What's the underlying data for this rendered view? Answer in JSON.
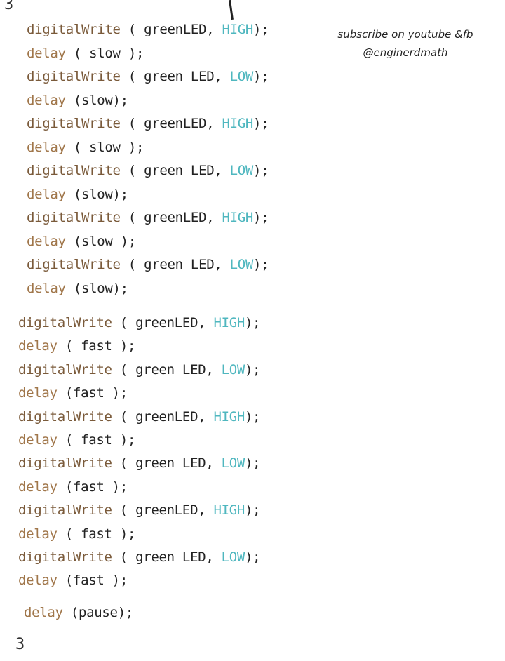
{
  "header": {
    "brace_open": "3",
    "brace_close": "3"
  },
  "note": {
    "line1": "subscribe on youtube &fb",
    "line2": "@enginerdmath"
  },
  "code": {
    "lines": [
      {
        "fn": "digitalWrite",
        "open": " ( ",
        "arg": "greenLED, ",
        "const": "HIGH",
        "close": ");"
      },
      {
        "fn": "delay",
        "open": " ( ",
        "arg": "slow",
        "const": "",
        "close": " );"
      },
      {
        "fn": "digitalWrite",
        "open": " ( ",
        "arg": "green LED, ",
        "const": "LOW",
        "close": ");"
      },
      {
        "fn": "delay",
        "open": " (",
        "arg": "slow",
        "const": "",
        "close": ");"
      },
      {
        "fn": "digitalWrite",
        "open": " ( ",
        "arg": "greenLED, ",
        "const": "HIGH",
        "close": ");"
      },
      {
        "fn": "delay",
        "open": " ( ",
        "arg": "slow",
        "const": "",
        "close": " );"
      },
      {
        "fn": "digitalWrite",
        "open": " ( ",
        "arg": "green LED, ",
        "const": "LOW",
        "close": ");"
      },
      {
        "fn": "delay",
        "open": " (",
        "arg": "slow",
        "const": "",
        "close": ");"
      },
      {
        "fn": "digitalWrite",
        "open": " ( ",
        "arg": "greenLED, ",
        "const": "HIGH",
        "close": ");"
      },
      {
        "fn": "delay",
        "open": " (",
        "arg": "slow",
        "const": "",
        "close": " );"
      },
      {
        "fn": "digitalWrite",
        "open": " ( ",
        "arg": "green LED, ",
        "const": "LOW",
        "close": ");"
      },
      {
        "fn": "delay",
        "open": " (",
        "arg": "slow",
        "const": "",
        "close": ");"
      },
      {
        "fn": "digitalWrite",
        "open": " ( ",
        "arg": "greenLED, ",
        "const": "HIGH",
        "close": ");"
      },
      {
        "fn": "delay",
        "open": " ( ",
        "arg": "fast",
        "const": "",
        "close": " );"
      },
      {
        "fn": "digitalWrite",
        "open": " ( ",
        "arg": "green LED, ",
        "const": "LOW",
        "close": ");"
      },
      {
        "fn": "delay",
        "open": " (",
        "arg": "fast",
        "const": "",
        "close": " );"
      },
      {
        "fn": "digitalWrite",
        "open": " ( ",
        "arg": "greenLED, ",
        "const": "HIGH",
        "close": ");"
      },
      {
        "fn": "delay",
        "open": " ( ",
        "arg": "fast",
        "const": "",
        "close": " );"
      },
      {
        "fn": "digitalWrite",
        "open": " ( ",
        "arg": "green LED, ",
        "const": "LOW",
        "close": ");"
      },
      {
        "fn": "delay",
        "open": " (",
        "arg": "fast",
        "const": "",
        "close": " );"
      },
      {
        "fn": "digitalWrite",
        "open": " ( ",
        "arg": "greenLED, ",
        "const": "HIGH",
        "close": ");"
      },
      {
        "fn": "delay",
        "open": " ( ",
        "arg": "fast",
        "const": "",
        "close": " );"
      },
      {
        "fn": "digitalWrite",
        "open": " ( ",
        "arg": "green LED, ",
        "const": "LOW",
        "close": ");"
      },
      {
        "fn": "delay",
        "open": " (",
        "arg": "fast",
        "const": "",
        "close": " );"
      },
      {
        "fn": "delay",
        "open": " (",
        "arg": "pause",
        "const": "",
        "close": ");"
      }
    ]
  },
  "colors": {
    "function": "#7a5a3a",
    "delay": "#a0764a",
    "constant": "#4fb7bf",
    "text": "#222222"
  }
}
